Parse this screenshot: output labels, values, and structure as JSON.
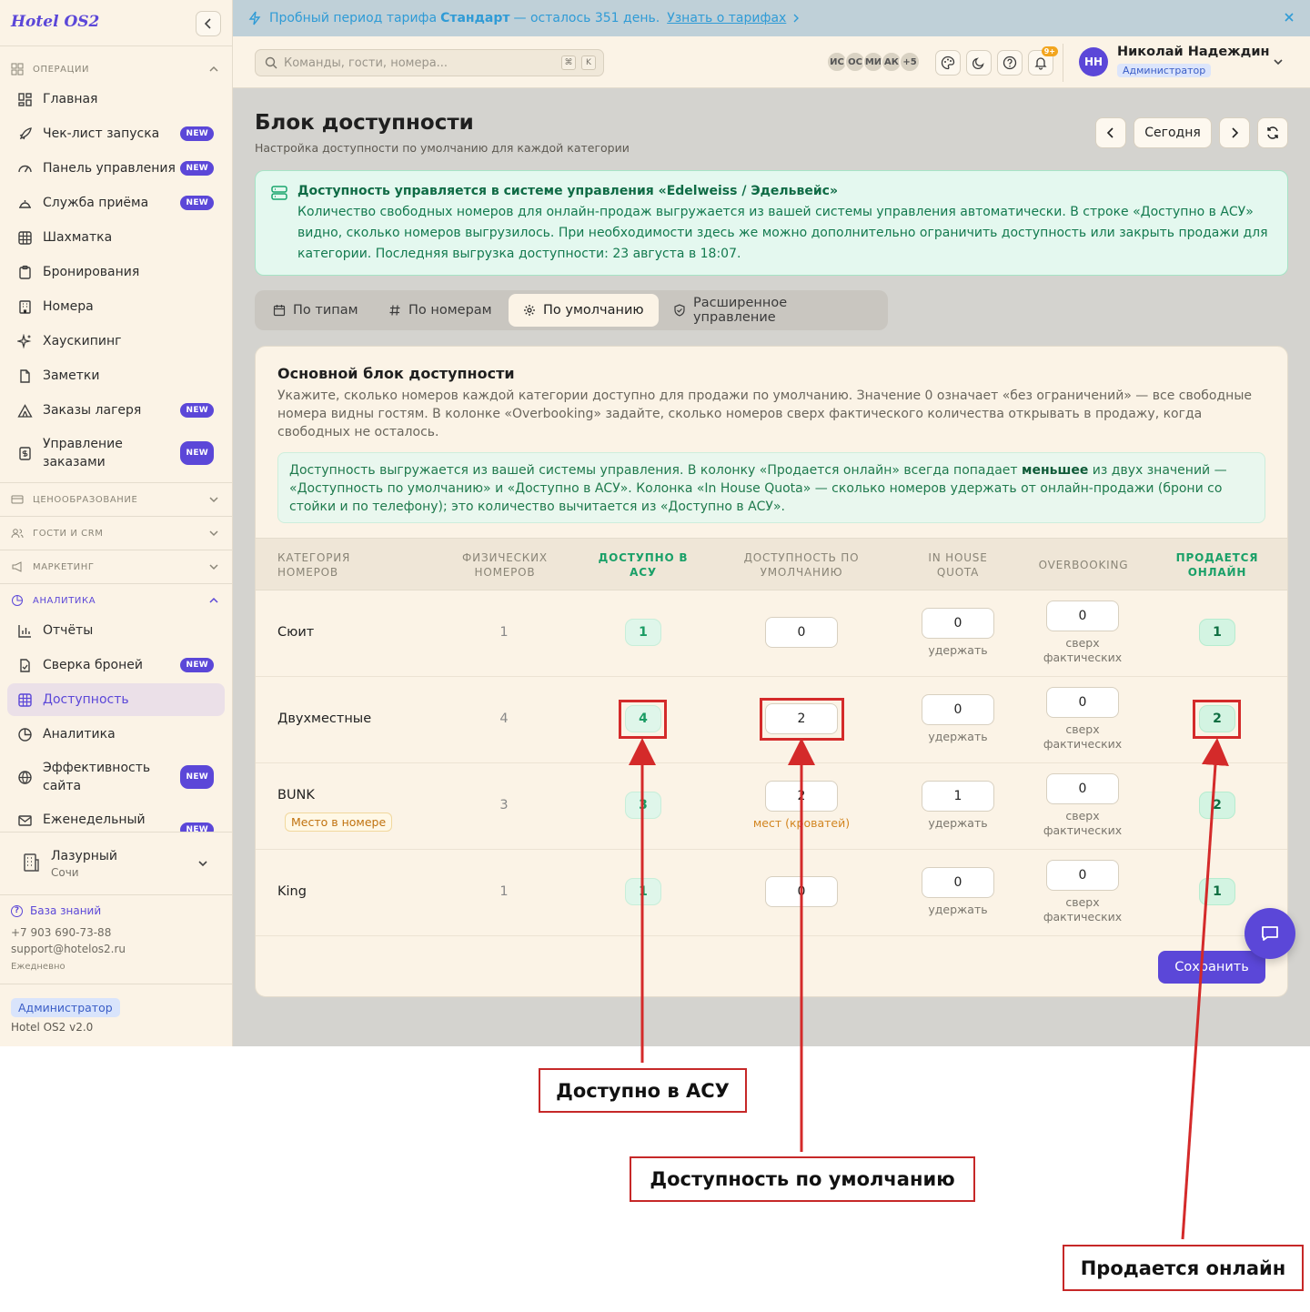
{
  "app": {
    "logo": "Hotel OS2"
  },
  "sidebar": {
    "sections": {
      "operations": "ОПЕРАЦИИ",
      "pricing": "ЦЕНООБРАЗОВАНИЕ",
      "guests": "ГОСТИ И CRM",
      "marketing": "МАРКЕТИНГ",
      "analytics": "АНАЛИТИКА"
    },
    "items": {
      "home": "Главная",
      "checklist": "Чек-лист запуска",
      "dashboard": "Панель управления",
      "frontdesk": "Служба приёма",
      "chess": "Шахматка",
      "bookings": "Бронирования",
      "rooms": "Номера",
      "housekeeping": "Хаускипинг",
      "notes": "Заметки",
      "camp_orders": "Заказы лагеря",
      "order_mgmt": "Управление заказами",
      "reports": "Отчёты",
      "reconciliation": "Сверка броней",
      "availability": "Доступность",
      "analytics": "Аналитика",
      "site_efficiency": "Эффективность сайта",
      "weekly": "Еженедельный"
    },
    "new_badge": "NEW",
    "hotel": {
      "name": "Лазурный",
      "city": "Сочи"
    },
    "knowledge_base": "База знаний",
    "phone": "+7 903 690-73-88",
    "email": "support@hotelos2.ru",
    "schedule": "Ежедневно",
    "role": "Администратор",
    "version": "Hotel OS2 v2.0"
  },
  "trial": {
    "prefix": "Пробный период тарифа",
    "plan": "Стандарт",
    "suffix": "— осталось 351 день.",
    "link": "Узнать о тарифах"
  },
  "topbar": {
    "search_placeholder": "Команды, гости, номера...",
    "kbd1": "⌘",
    "kbd2": "K",
    "avatars": [
      "ИС",
      "ОС",
      "МИ",
      "АК",
      "+5"
    ],
    "notif_count": "9+",
    "user_initials": "НН",
    "user_name": "Николай Надеждин",
    "user_role": "Администратор"
  },
  "page": {
    "title": "Блок доступности",
    "subtitle": "Настройка доступности по умолчанию для каждой категории",
    "today": "Сегодня"
  },
  "info": {
    "title": "Доступность управляется в системе управления «Edelweiss / Эдельвейс»",
    "text": "Количество свободных номеров для онлайн-продаж выгружается из вашей системы управления автоматически. В строке «Доступно в АСУ» видно, сколько номеров выгрузилось. При необходимости здесь же можно дополнительно ограничить доступность или закрыть продажи для категории. Последняя выгрузка доступности: 23 августа в 18:07."
  },
  "tabs": {
    "by_type": "По типам",
    "by_room": "По номерам",
    "default": "По умолчанию",
    "advanced": "Расширенное управление"
  },
  "card": {
    "title": "Основной блок доступности",
    "desc": "Укажите, сколько номеров каждой категории доступно для продажи по умолчанию. Значение 0 означает «без ограничений» — все свободные номера видны гостям. В колонке «Overbooking» задайте, сколько номеров сверх фактического количества открывать в продажу, когда свободных не осталось.",
    "note_a": "Доступность выгружается из вашей системы управления. В колонку «Продается онлайн» всегда попадает",
    "note_bold": "меньшее",
    "note_b": "из двух значений — «Доступность по умолчанию» и «Доступно в АСУ». Колонка «In House Quota» — сколько номеров удержать от онлайн-продажи (брони со стойки и по телефону); это количество вычитается из «Доступно в АСУ».",
    "save": "Сохранить"
  },
  "table": {
    "headers": {
      "category": "КАТЕГОРИЯ НОМЕРОВ",
      "physical": "ФИЗИЧЕСКИХ НОМЕРОВ",
      "asu": "ДОСТУПНО В АСУ",
      "default": "ДОСТУПНОСТЬ ПО УМОЛЧАНИЮ",
      "quota": "IN HOUSE QUOTA",
      "overbooking": "OVERBOOKING",
      "online": "ПРОДАЕТСЯ ОНЛАЙН"
    },
    "hint_hold": "удержать",
    "hint_over_1": "сверх",
    "hint_over_2": "фактических",
    "rows": [
      {
        "name": "Сюит",
        "physical": "1",
        "asu": "1",
        "default": "0",
        "quota": "0",
        "overbooking": "0",
        "online": "1",
        "pill": "",
        "beds_hint": ""
      },
      {
        "name": "Двухместные",
        "physical": "4",
        "asu": "4",
        "default": "2",
        "quota": "0",
        "overbooking": "0",
        "online": "2",
        "pill": "",
        "beds_hint": ""
      },
      {
        "name": "BUNK",
        "physical": "3",
        "asu": "3",
        "default": "2",
        "quota": "1",
        "overbooking": "0",
        "online": "2",
        "pill": "Место в номере",
        "beds_hint": "мест (кроватей)"
      },
      {
        "name": "King",
        "physical": "1",
        "asu": "1",
        "default": "0",
        "quota": "0",
        "overbooking": "0",
        "online": "1",
        "pill": "",
        "beds_hint": ""
      }
    ]
  },
  "annotations": {
    "asu": "Доступно в АСУ",
    "default": "Доступность по умолчанию",
    "online": "Продается онлайн",
    "color": "#d42a2a"
  },
  "colors": {
    "accent": "#5b47d8",
    "success": "#1aa068",
    "trial": "#2f9bd6"
  }
}
